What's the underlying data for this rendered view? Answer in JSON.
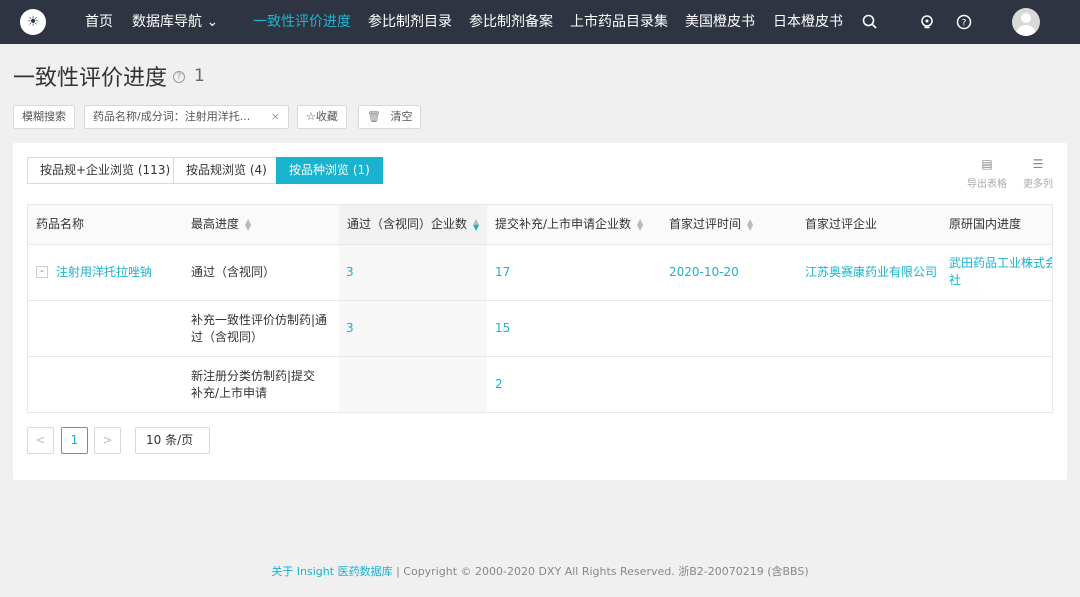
{
  "nav": {
    "logo": "☀",
    "items": [
      "首页",
      "数据库导航 ⌄",
      "一致性评价进度",
      "参比制剂目录",
      "参比制剂备案",
      "上市药品目录集",
      "美国橙皮书",
      "日本橙皮书"
    ]
  },
  "page": {
    "title": "一致性评价进度",
    "count": "1",
    "help": "?"
  },
  "filters": {
    "fuzzy": "模糊搜索",
    "query": "药品名称/成分词：注射用洋托...",
    "close": "×",
    "favorite": "☆收藏",
    "clear": "清空",
    "clear_icon": "🗑"
  },
  "tabs": [
    "按品规+企业浏览 (113)",
    "按品规浏览 (4)",
    "按品种浏览 (1)"
  ],
  "tools": {
    "export": "导出表格",
    "more": "更多列"
  },
  "table": {
    "headers": [
      "药品名称",
      "最高进度",
      "通过（含视同）企业数",
      "提交补充/上市申请企业数",
      "首家过评时间",
      "首家过评企业",
      "原研国内进度"
    ],
    "rows": [
      {
        "name": "注射用洋托拉唑钠",
        "progress": "通过（含视同）",
        "passed": "3",
        "submitted": "17",
        "first_date": "2020-10-20",
        "first_company": "江苏奥赛康药业有限公司",
        "original": "武田药品工业株式会社\n已获文号"
      },
      {
        "name": "",
        "progress": "补充一致性评价仿制药|通过（含视同）",
        "passed": "3",
        "submitted": "15",
        "first_date": "",
        "first_company": "",
        "original": ""
      },
      {
        "name": "",
        "progress": "新注册分类仿制药|提交补充/上市申请",
        "passed": "",
        "submitted": "2",
        "first_date": "",
        "first_company": "",
        "original": ""
      }
    ]
  },
  "pagination": {
    "prev": "<",
    "current": "1",
    "next": ">",
    "page_size": "10 条/页"
  },
  "footer": {
    "link": "关于 Insight 医药数据库",
    "text": " | Copyright © 2000-2020 DXY All Rights Reserved. 浙B2-20070219 (含BBS)"
  },
  "colors": {
    "accent": "#17b3cf",
    "nav_bg": "#2f3442"
  }
}
